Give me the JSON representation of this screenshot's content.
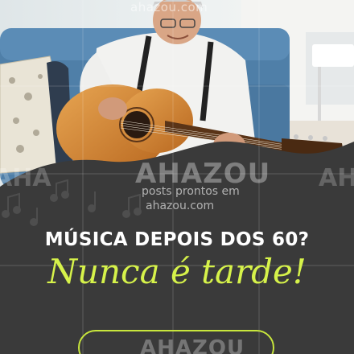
{
  "headline": "MÚSICA DEPOIS DOS 60?",
  "script_line": "Nunca é tarde!",
  "watermark": {
    "top": "ahazou.com",
    "big": "AHAZOU",
    "line1": "posts prontos em",
    "line2": "ahazou.com",
    "side_left": "AHA",
    "side_right": "AH",
    "bottom": "AHAZOU"
  },
  "colors": {
    "background": "#3a3a3a",
    "accent": "#d6f24a",
    "headline": "#ffffff"
  },
  "icons": [
    "music-note-icon"
  ]
}
